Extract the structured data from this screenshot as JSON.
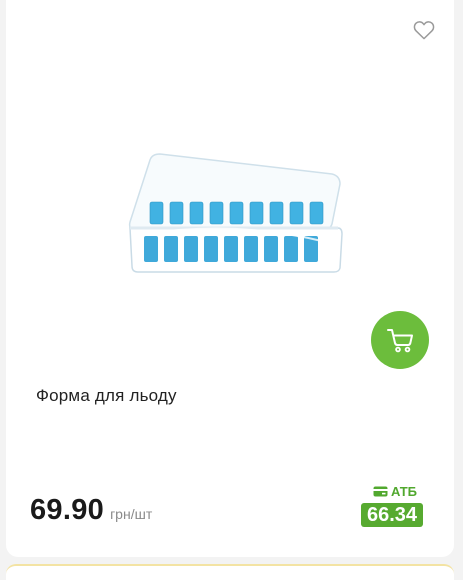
{
  "product": {
    "title": "Форма для льоду",
    "price": "69.90",
    "unit": "грн/шт",
    "loyalty_label": "АТБ",
    "discount_price": "66.34"
  },
  "icons": {
    "favorite": "heart-outline-icon",
    "cart": "shopping-cart-icon",
    "loyalty_card": "card-icon"
  },
  "colors": {
    "accent_green": "#6cbd3c",
    "discount_green": "#57aa30",
    "ice_blue": "#3fb1e0"
  }
}
